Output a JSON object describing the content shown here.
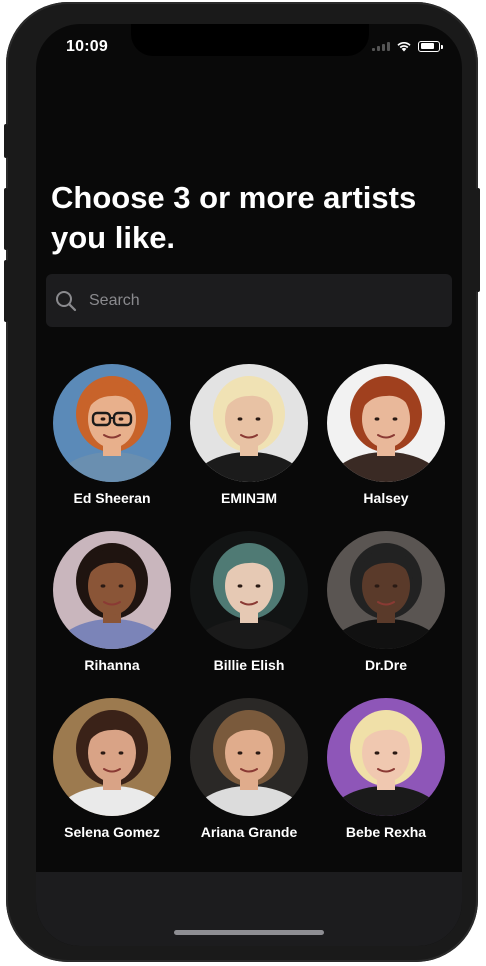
{
  "status_bar": {
    "time": "10:09",
    "battery_level": 0.85
  },
  "page": {
    "title": "Choose 3 or more artists you like."
  },
  "search": {
    "placeholder": "Search",
    "value": ""
  },
  "artists": [
    {
      "name": "Ed Sheeran",
      "bg": "#5b8ab8",
      "skin": "#e8b08c",
      "hair": "#c8632a",
      "shirt": "#6a8fb0",
      "glasses": true
    },
    {
      "name": "EMINƎM",
      "bg": "#e3e3e3",
      "skin": "#e8c2a4",
      "hair": "#f0e2b4",
      "shirt": "#1b1b1b",
      "glasses": false
    },
    {
      "name": "Halsey",
      "bg": "#f2f2f2",
      "skin": "#e9b89a",
      "hair": "#a0401e",
      "shirt": "#3a2a24",
      "glasses": false
    },
    {
      "name": "Rihanna",
      "bg": "#c9b6bd",
      "skin": "#8a5537",
      "hair": "#1f1410",
      "shirt": "#7b84b8",
      "glasses": false
    },
    {
      "name": "Billie Elish",
      "bg": "#121414",
      "skin": "#e6c9b4",
      "hair": "#4f7a74",
      "shirt": "#1a1a1a",
      "glasses": false
    },
    {
      "name": "Dr.Dre",
      "bg": "#5a5552",
      "skin": "#5a3a2a",
      "hair": "#222222",
      "shirt": "#111111",
      "glasses": false
    },
    {
      "name": "Selena Gomez",
      "bg": "#9c7a4f",
      "skin": "#d9a386",
      "hair": "#3a2218",
      "shirt": "#eaeaea",
      "glasses": false
    },
    {
      "name": "Ariana Grande",
      "bg": "#2a2826",
      "skin": "#e0ac8c",
      "hair": "#7a5a3c",
      "shirt": "#dcdcdc",
      "glasses": false
    },
    {
      "name": "Bebe Rexha",
      "bg": "#8e56b8",
      "skin": "#f0c8b0",
      "hair": "#f0e0a8",
      "shirt": "#1a1a1a",
      "glasses": false
    }
  ]
}
